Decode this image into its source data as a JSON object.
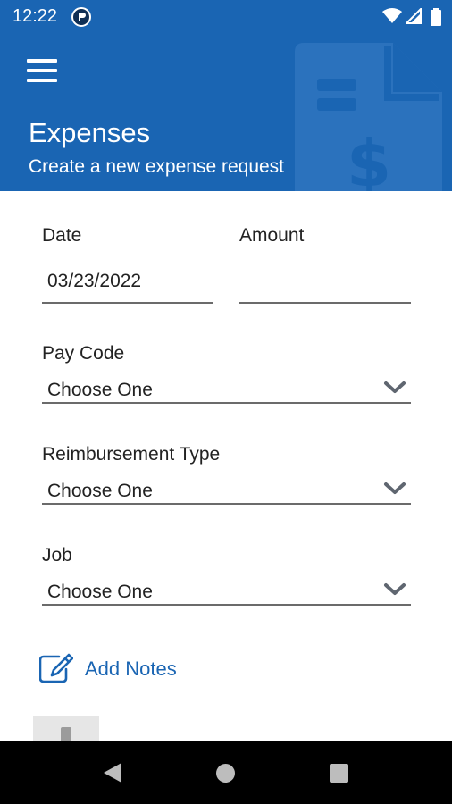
{
  "status_bar": {
    "time": "12:22",
    "icons": [
      "app-notification-icon",
      "wifi-icon",
      "signal-icon",
      "battery-icon"
    ]
  },
  "header": {
    "menu_icon": "hamburger-menu-icon",
    "title": "Expenses",
    "subtitle": "Create a new expense request",
    "watermark_icon": "document-dollar-icon",
    "background_color": "#1a65b3"
  },
  "form": {
    "date": {
      "label": "Date",
      "value": "03/23/2022"
    },
    "amount": {
      "label": "Amount",
      "value": ""
    },
    "pay_code": {
      "label": "Pay Code",
      "selected": "Choose One"
    },
    "reimbursement_type": {
      "label": "Reimbursement Type",
      "selected": "Choose One"
    },
    "job": {
      "label": "Job",
      "selected": "Choose One"
    },
    "add_notes": {
      "label": "Add Notes",
      "icon": "edit-note-icon"
    }
  },
  "nav_bar": {
    "icons": [
      "back-triangle-icon",
      "home-circle-icon",
      "recents-square-icon"
    ]
  }
}
